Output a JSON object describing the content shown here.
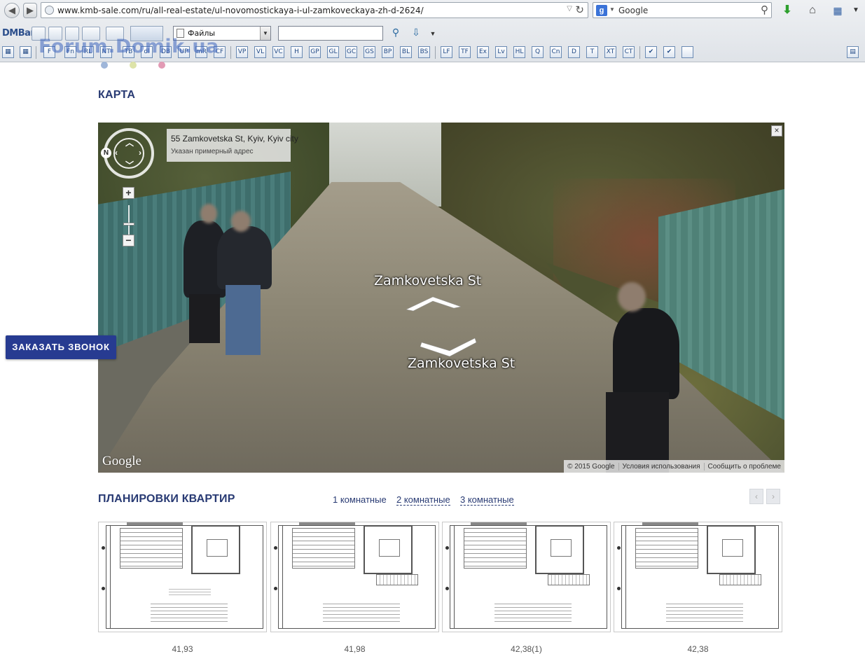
{
  "browser": {
    "url": "www.kmb-sale.com/ru/all-real-estate/ul-novomostickaya-i-ul-zamkoveckaya-zh-d-2624/",
    "search_engine": "g",
    "search_placeholder": "Google"
  },
  "dmbar": {
    "logo": "DMBar",
    "dropdown_value": "Файлы",
    "search_value": "",
    "buttons": [
      "F",
      "Fn",
      "RL",
      "NT",
      "TB",
      "dl",
      "DB",
      "UP",
      "mR",
      "CF",
      "VP",
      "VL",
      "VC",
      "H",
      "GP",
      "GL",
      "GC",
      "GS",
      "BP",
      "BL",
      "BS",
      "LF",
      "TF",
      "Ex",
      "Lv",
      "HL",
      "Q",
      "Cn",
      "D",
      "T",
      "XT",
      "CT",
      "✔",
      "✔",
      ""
    ]
  },
  "watermark": "Forum.Domik.ua",
  "colors": {
    "brand": "#283a73",
    "call_button": "#273b91",
    "dot1": "#9fb6d9",
    "dot2": "#dde3a8",
    "dot3": "#e29ab4"
  },
  "map_section": {
    "title": "КАРТА",
    "address": "55 Zamkovetska St, Kyiv, Kyiv city",
    "address_note": "Указан примерный адрес",
    "street_label_top": "Zamkovetska St",
    "street_label_bottom": "Zamkovetska St",
    "google_logo": "Google",
    "footer": [
      "© 2015 Google",
      "Условия использования",
      "Сообщить о проблеме"
    ],
    "close": "×",
    "compass": "N",
    "zoom_in": "+",
    "zoom_out": "−"
  },
  "call_button": "ЗАКАЗАТЬ ЗВОНОК",
  "plans_section": {
    "title": "ПЛАНИРОВКИ КВАРТИР",
    "tabs": [
      "1 комнатные",
      "2 комнатные",
      "3 комнатные"
    ],
    "prev": "‹",
    "next": "›",
    "cards": [
      {
        "area": "41,93"
      },
      {
        "area": "41,98"
      },
      {
        "area": "42,38(1)"
      },
      {
        "area": "42,38"
      }
    ]
  }
}
